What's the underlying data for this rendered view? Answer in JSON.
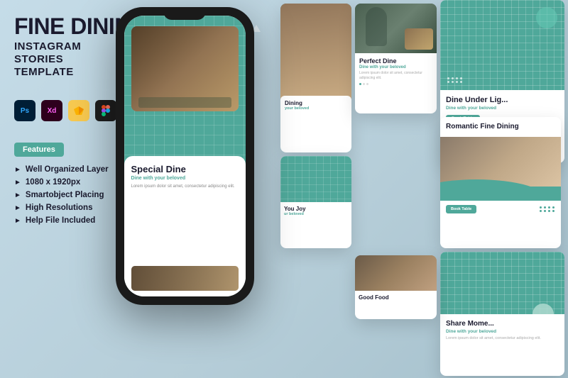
{
  "title": {
    "line1": "FINE DINING",
    "line2": "INSTAGRAM",
    "line3": "STORIES",
    "line4": "TEMPLATE"
  },
  "app_icons": [
    {
      "name": "Ps",
      "label": "Photoshop"
    },
    {
      "name": "Xd",
      "label": "Adobe XD"
    },
    {
      "name": "Sk",
      "label": "Sketch"
    },
    {
      "name": "Fig",
      "label": "Figma"
    }
  ],
  "features": {
    "label": "Features",
    "items": [
      "Well Organized Layer",
      "1080 x 1920px",
      "Smartobject Placing",
      "High Resolutions",
      "Help File Included"
    ]
  },
  "phone": {
    "card_title": "Special Dine",
    "card_subtitle": "Dine with your beloved",
    "card_lorem": "Lorem ipsum dolor sit amet, consectetur adipiscing elit."
  },
  "cards": {
    "perfect_dine": {
      "title": "Perfect Dine",
      "subtitle": "Dine with your beloved",
      "lorem": "Lorem ipsum dolor sit amet, consectetur adipiscing elit."
    },
    "dine_under_light": {
      "title": "Dine Under Lig...",
      "subtitle": "Dine with your beloved",
      "book_label": "Book Table"
    },
    "romantic_fine_dining": {
      "title": "Romantic Fine Dining",
      "book_label": "Book Table"
    },
    "share_moments": {
      "title": "Share Mome...",
      "subtitle": "Dine with your beloved",
      "lorem": "Lorem ipsum dolor sit amet, consectetur adipiscing elit."
    },
    "good_food": {
      "title": "Good Food"
    },
    "dining_left": {
      "title": "Dining",
      "subtitle": "your beloved"
    },
    "you_joy": {
      "title": "You Joy",
      "subtitle": "ur beloved"
    }
  }
}
